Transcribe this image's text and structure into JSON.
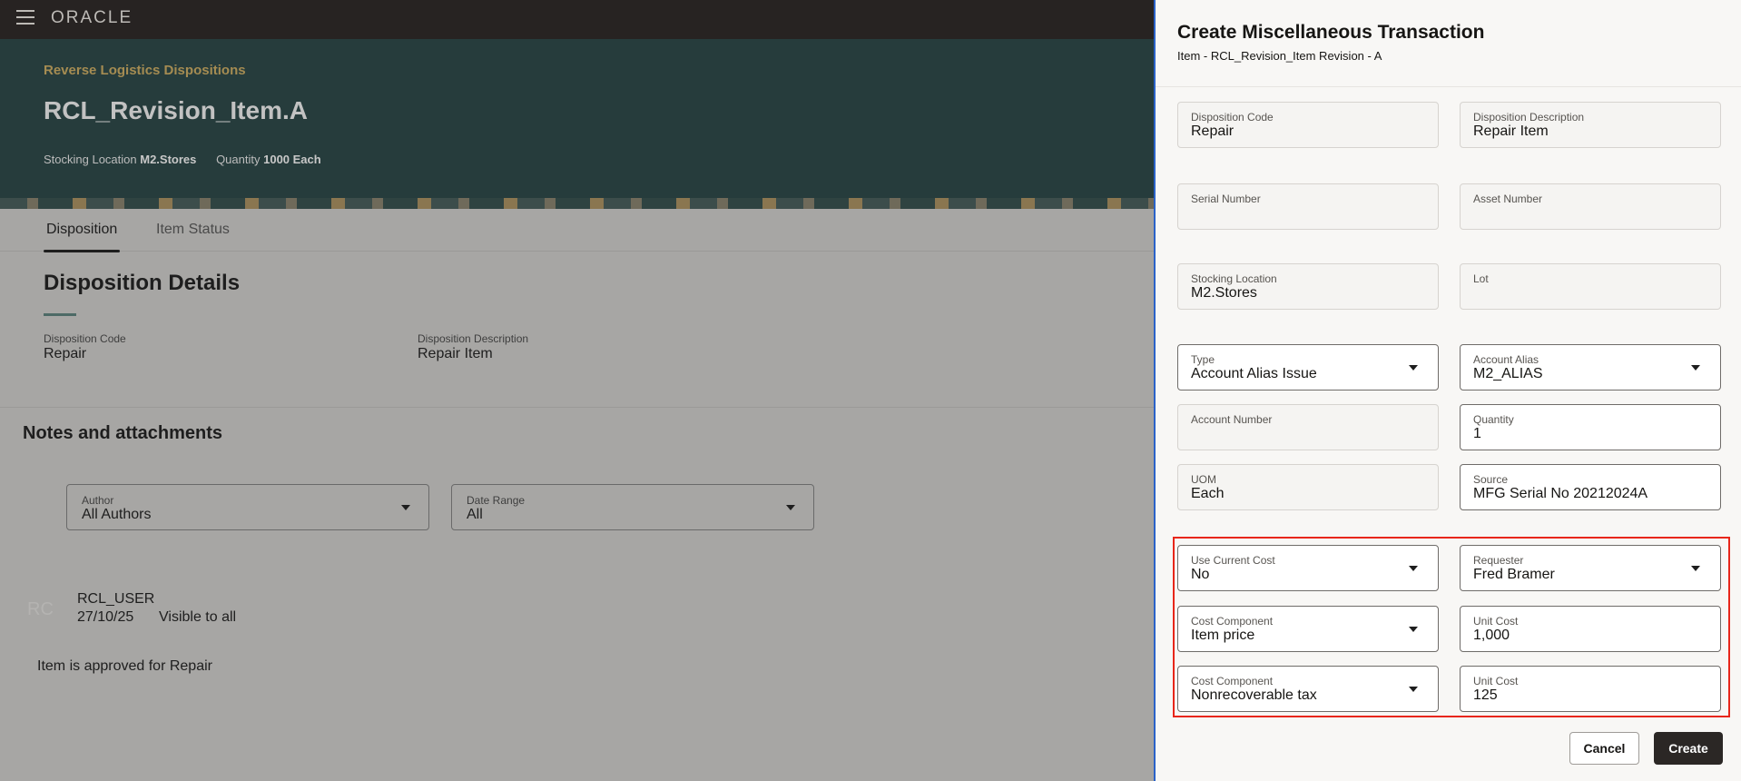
{
  "app": {
    "logo": "ORACLE"
  },
  "hero": {
    "breadcrumb": "Reverse Logistics Dispositions",
    "title": "RCL_Revision_Item.A",
    "stocking_label": "Stocking Location",
    "stocking_value": "M2.Stores",
    "quantity_label": "Quantity",
    "quantity_value": "1000 Each"
  },
  "tabs": [
    {
      "label": "Disposition"
    },
    {
      "label": "Item Status"
    }
  ],
  "details": {
    "heading": "Disposition Details",
    "code_label": "Disposition Code",
    "code_value": "Repair",
    "desc_label": "Disposition Description",
    "desc_value": "Repair Item"
  },
  "notes": {
    "heading": "Notes and attachments",
    "author_label": "Author",
    "author_value": "All Authors",
    "range_label": "Date Range",
    "range_value": "All",
    "avatar": "RC",
    "user": "RCL_USER",
    "date": "27/10/25",
    "visibility": "Visible to all",
    "text": "Item is approved for Repair"
  },
  "dialog": {
    "title": "Create Miscellaneous Transaction",
    "subtitle": "Item - RCL_Revision_Item Revision - A",
    "fields": [
      {
        "label": "Disposition Code",
        "value": "Repair"
      },
      {
        "label": "Disposition Description",
        "value": "Repair Item"
      },
      {
        "label": "Serial Number",
        "value": ""
      },
      {
        "label": "Asset Number",
        "value": ""
      },
      {
        "label": "Stocking Location",
        "value": "M2.Stores"
      },
      {
        "label": "Lot",
        "value": ""
      },
      {
        "label": "Type",
        "value": "Account Alias Issue"
      },
      {
        "label": "Account Alias",
        "value": "M2_ALIAS"
      },
      {
        "label": "Account Number",
        "value": ""
      },
      {
        "label": "Quantity",
        "value": "1"
      },
      {
        "label": "UOM",
        "value": "Each"
      },
      {
        "label": "Source",
        "value": "MFG Serial No 20212024A"
      },
      {
        "label": "Use Current Cost",
        "value": "No"
      },
      {
        "label": "Requester",
        "value": "Fred Bramer"
      },
      {
        "label": "Cost Component",
        "value": "Item price"
      },
      {
        "label": "Unit Cost",
        "value": "1,000"
      },
      {
        "label": "Cost Component",
        "value": "Nonrecoverable tax"
      },
      {
        "label": "Unit Cost",
        "value": "125"
      }
    ],
    "cancel": "Cancel",
    "create": "Create",
    "highlight_color": "#e8261a"
  }
}
